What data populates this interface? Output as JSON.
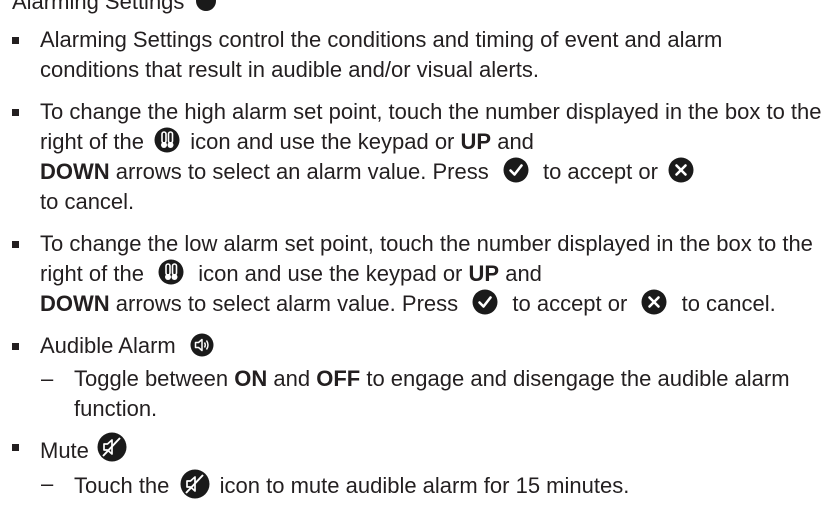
{
  "colors": {
    "text": "#231f20",
    "icon_fill": "#1a1a1a",
    "icon_glyph": "#ffffff"
  },
  "header": {
    "partial_text": "Alarming Settings"
  },
  "items": [
    {
      "text": "Alarming Settings control the conditions and timing of event and alarm conditions that result in audible and/or visual alerts."
    },
    {
      "p1": "To change the high alarm set point, touch the number displayed in the box to the right of the",
      "p2": "icon and use the keypad or",
      "up": "UP",
      "p3": "and",
      "down": "DOWN",
      "p4": "arrows to select an alarm value. Press",
      "p5": "to accept or",
      "p6": "to cancel.",
      "icons": [
        "thermometer-icon",
        "checkmark-icon",
        "cancel-icon"
      ]
    },
    {
      "p1": "To change the low alarm set point, touch the number displayed in the box to the right of the",
      "p2": "icon and use the keypad or",
      "up": "UP",
      "p3": "and",
      "down": "DOWN",
      "p4": "arrows to select alarm value. Press",
      "p5": "to accept or",
      "p6": "to cancel.",
      "icons": [
        "thermometer-icon",
        "checkmark-icon",
        "cancel-icon"
      ]
    },
    {
      "label": "Audible Alarm",
      "icon": "speaker-icon",
      "sub": {
        "dash": "–",
        "p1": "Toggle between",
        "on": "ON",
        "p2": "and",
        "off": "OFF",
        "p3": "to engage and disengage the audible alarm function."
      }
    },
    {
      "label": "Mute",
      "icon": "mute-icon",
      "sub": {
        "dash": "–",
        "p1": "Touch the",
        "p2": "icon to mute audible alarm for 15 minutes."
      }
    }
  ]
}
